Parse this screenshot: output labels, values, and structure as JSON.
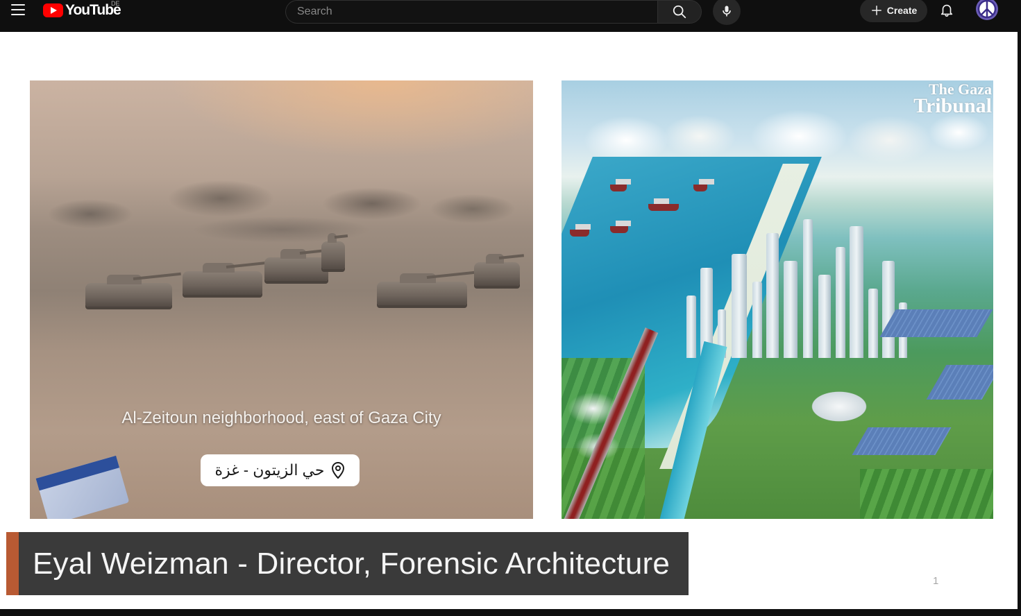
{
  "header": {
    "logo_text": "YouTube",
    "country_code": "DE",
    "search_placeholder": "Search",
    "create_label": "Create",
    "icons": [
      "menu-icon",
      "search-icon",
      "mic-icon",
      "plus-icon",
      "bell-icon",
      "peace-avatar-icon"
    ]
  },
  "video": {
    "left_caption_en": "Al-Zeitoun neighborhood, east of Gaza City",
    "left_caption_ar": "حي الزيتون - غزة",
    "right_watermark_line1": "The Gaza",
    "right_watermark_line2": "Tribunal",
    "lower_third": "Eyal Weizman - Director, Forensic Architecture",
    "slide_number": "1"
  },
  "colors": {
    "brand_red": "#ff0000",
    "lower_third_bg": "#3a3a3a",
    "lower_third_accent": "#b85a33"
  }
}
